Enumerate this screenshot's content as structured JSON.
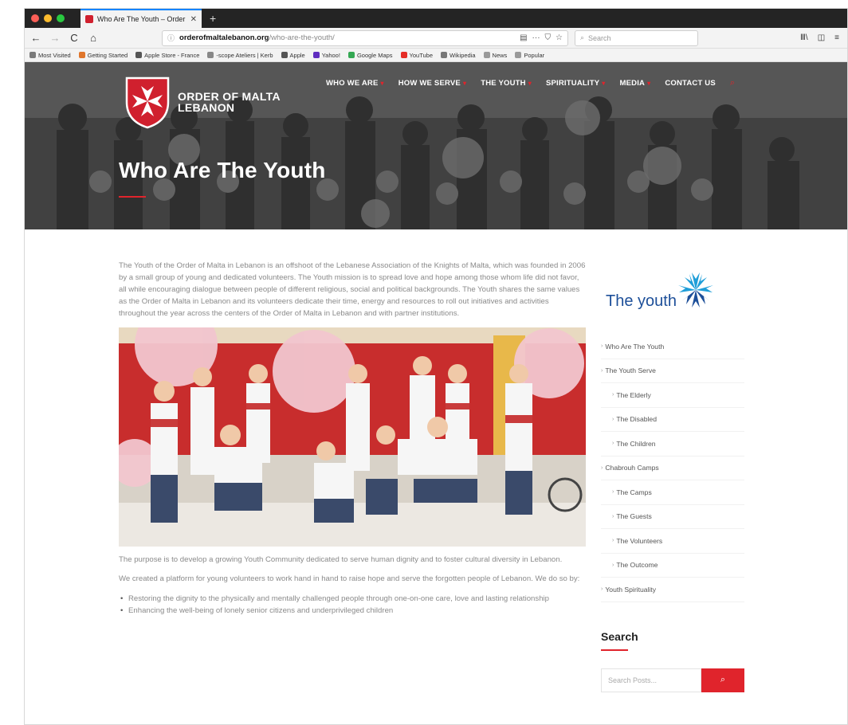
{
  "browser": {
    "tab_title": "Who Are The Youth – Order of Malta",
    "tab_close": "✕",
    "new_tab": "+",
    "url_domain": "orderofmaltalebanon.org",
    "url_path": "/who-are-the-youth/",
    "search_placeholder": "Search",
    "nav": {
      "back": "←",
      "forward": "→",
      "reload": "C",
      "home": "⌂"
    },
    "url_icons": {
      "reader": "▤",
      "more": "···",
      "pocket": "⛉",
      "star": "☆"
    },
    "right_icons": {
      "library": "Ⅲ\\",
      "sidebar": "◫",
      "menu": "≡"
    },
    "bookmarks": [
      {
        "label": "Most Visited",
        "color": "#7a7a7a"
      },
      {
        "label": "Getting Started",
        "color": "#e0762c"
      },
      {
        "label": "Apple Store - France",
        "color": "#555555"
      },
      {
        "label": "-scope Ateliers | Kerb",
        "color": "#888888"
      },
      {
        "label": "Apple",
        "color": "#555555"
      },
      {
        "label": "Yahoo!",
        "color": "#5f2dbf"
      },
      {
        "label": "Google Maps",
        "color": "#34a853"
      },
      {
        "label": "YouTube",
        "color": "#e52d27"
      },
      {
        "label": "Wikipedia",
        "color": "#777777"
      },
      {
        "label": "News",
        "color": "#999999"
      },
      {
        "label": "Popular",
        "color": "#999999"
      }
    ]
  },
  "site": {
    "logo_line1": "ORDER OF MALTA",
    "logo_line2": "LEBANON",
    "nav": [
      "WHO WE ARE",
      "HOW WE SERVE",
      "THE YOUTH",
      "SPIRITUALITY",
      "MEDIA",
      "CONTACT US"
    ],
    "hero_title": "Who Are The Youth",
    "accent": "#e0242c"
  },
  "content": {
    "intro": "The Youth of the Order of Malta in Lebanon is an offshoot of the Lebanese Association of the Knights of Malta, which was founded in 2006 by a small group of young and dedicated volunteers. The Youth mission is to spread love and hope among those whom life did not favor, all while encouraging dialogue between people of different religious, social and political backgrounds. The Youth shares the same values as the Order of Malta in Lebanon and its volunteers dedicate their time, energy and resources to roll out initiatives and activities throughout the year across the centers of the Order of Malta in Lebanon and with partner institutions.",
    "purpose": "The purpose is to develop a growing Youth Community dedicated to serve human dignity and to foster cultural diversity in Lebanon.",
    "platform": "We created a platform for young volunteers to work hand in hand to raise hope and serve the forgotten people of Lebanon. We do so by:",
    "bullets": [
      "Restoring the dignity to the physically and mentally challenged people through one-on-one care, love and lasting relationship",
      "Enhancing the well-being of lonely senior citizens and underprivileged children"
    ]
  },
  "sidebar": {
    "logo_text": "The youth",
    "menu": [
      {
        "label": "Who Are The Youth",
        "sub": false
      },
      {
        "label": "The Youth Serve",
        "sub": false
      },
      {
        "label": "The Elderly",
        "sub": true
      },
      {
        "label": "The Disabled",
        "sub": true
      },
      {
        "label": "The Children",
        "sub": true
      },
      {
        "label": "Chabrouh Camps",
        "sub": false
      },
      {
        "label": "The Camps",
        "sub": true
      },
      {
        "label": "The Guests",
        "sub": true
      },
      {
        "label": "The Volunteers",
        "sub": true
      },
      {
        "label": "The Outcome",
        "sub": true
      },
      {
        "label": "Youth Spirituality",
        "sub": false
      }
    ],
    "search_title": "Search",
    "search_placeholder": "Search Posts..."
  }
}
